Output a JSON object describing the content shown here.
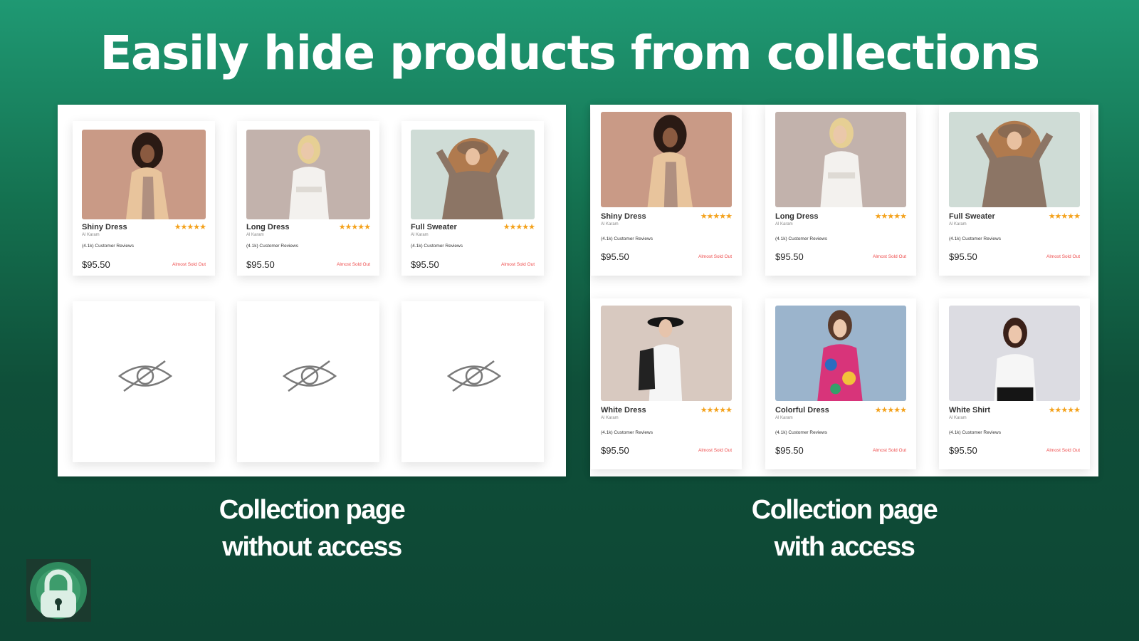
{
  "headline": "Easily hide products from collections",
  "colors": {
    "background_top": "#1f9973",
    "background_bottom": "#0d4634",
    "star": "#f4a21c",
    "stock_alert": "#ee4b4b"
  },
  "panels": [
    {
      "caption_line1": "Collection page",
      "caption_line2": "without access",
      "products": [
        {
          "name": "Shiny Dress",
          "brand": "Al Karam",
          "stars": "★★★★★",
          "reviews": "(4.1k) Customer Reviews",
          "price": "$95.50",
          "stock": "Almost Sold Out"
        },
        {
          "name": "Long Dress",
          "brand": "Al Karam",
          "stars": "★★★★★",
          "reviews": "(4.1k) Customer Reviews",
          "price": "$95.50",
          "stock": "Almost Sold Out"
        },
        {
          "name": "Full Sweater",
          "brand": "Al Karam",
          "stars": "★★★★★",
          "reviews": "(4.1k) Customer Reviews",
          "price": "$95.50",
          "stock": "Almost Sold Out"
        }
      ],
      "hidden_count": 3
    },
    {
      "caption_line1": "Collection page",
      "caption_line2": "with access",
      "products": [
        {
          "name": "Shiny Dress",
          "brand": "Al Karam",
          "stars": "★★★★★",
          "reviews": "(4.1k) Customer Reviews",
          "price": "$95.50",
          "stock": "Almost Sold Out"
        },
        {
          "name": "Long Dress",
          "brand": "Al Karam",
          "stars": "★★★★★",
          "reviews": "(4.1k) Customer Reviews",
          "price": "$95.50",
          "stock": "Almost Sold Out"
        },
        {
          "name": "Full Sweater",
          "brand": "Al Karam",
          "stars": "★★★★★",
          "reviews": "(4.1k) Customer Reviews",
          "price": "$95.50",
          "stock": "Almost Sold Out"
        },
        {
          "name": "White Dress",
          "brand": "Al Karam",
          "stars": "★★★★★",
          "reviews": "(4.1k) Customer Reviews",
          "price": "$95.50",
          "stock": "Almost Sold Out"
        },
        {
          "name": "Colorful Dress",
          "brand": "Al Karam",
          "stars": "★★★★★",
          "reviews": "(4.1k) Customer Reviews",
          "price": "$95.50",
          "stock": "Almost Sold Out"
        },
        {
          "name": "White Shirt",
          "brand": "Al Karam",
          "stars": "★★★★★",
          "reviews": "(4.1k) Customer Reviews",
          "price": "$95.50",
          "stock": "Almost Sold Out"
        }
      ]
    }
  ],
  "icons": {
    "hidden_product": "eye-slash-icon",
    "app_logo": "lock-icon"
  }
}
